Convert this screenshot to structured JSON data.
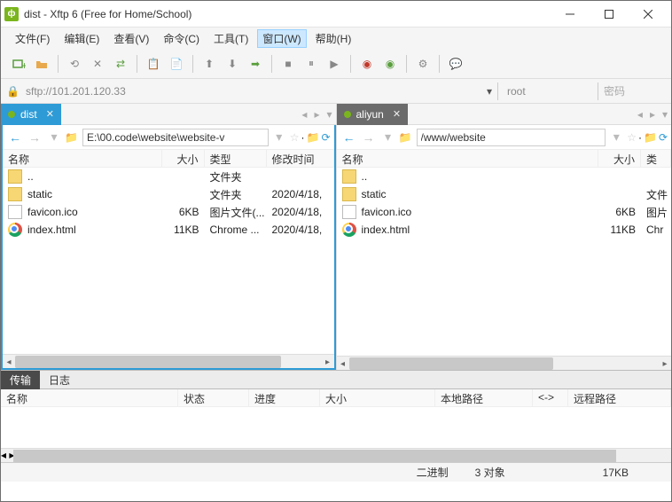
{
  "title": "dist - Xftp 6 (Free for Home/School)",
  "menus": [
    "文件(F)",
    "编辑(E)",
    "查看(V)",
    "命令(C)",
    "工具(T)",
    "窗口(W)",
    "帮助(H)"
  ],
  "active_menu_index": 5,
  "address": "sftp://101.201.120.33",
  "user": "root",
  "password_placeholder": "密码",
  "left": {
    "tab": "dist",
    "path": "E:\\00.code\\website\\website-v",
    "cols": {
      "name": "名称",
      "size": "大小",
      "type": "类型",
      "date": "修改时间"
    },
    "rows": [
      {
        "icon": "folder",
        "name": "..",
        "size": "",
        "type": "文件夹",
        "date": ""
      },
      {
        "icon": "folder",
        "name": "static",
        "size": "",
        "type": "文件夹",
        "date": "2020/4/18,"
      },
      {
        "icon": "file",
        "name": "favicon.ico",
        "size": "6KB",
        "type": "图片文件(...",
        "date": "2020/4/18,"
      },
      {
        "icon": "chrome",
        "name": "index.html",
        "size": "11KB",
        "type": "Chrome ...",
        "date": "2020/4/18,"
      }
    ]
  },
  "right": {
    "tab": "aliyun",
    "path": "/www/website",
    "cols": {
      "name": "名称",
      "size": "大小",
      "type": "类型"
    },
    "rows": [
      {
        "icon": "folder",
        "name": "..",
        "size": "",
        "type": ""
      },
      {
        "icon": "folder",
        "name": "static",
        "size": "",
        "type": "文件"
      },
      {
        "icon": "file",
        "name": "favicon.ico",
        "size": "6KB",
        "type": "图片"
      },
      {
        "icon": "chrome",
        "name": "index.html",
        "size": "11KB",
        "type": "Chr"
      }
    ]
  },
  "bottom_tabs": [
    "传输",
    "日志"
  ],
  "transfer_cols": {
    "name": "名称",
    "status": "状态",
    "progress": "进度",
    "size": "大小",
    "local": "本地路径",
    "arrow": "<->",
    "remote": "远程路径"
  },
  "status": {
    "mode": "二进制",
    "objects": "3 对象",
    "total": "17KB"
  }
}
